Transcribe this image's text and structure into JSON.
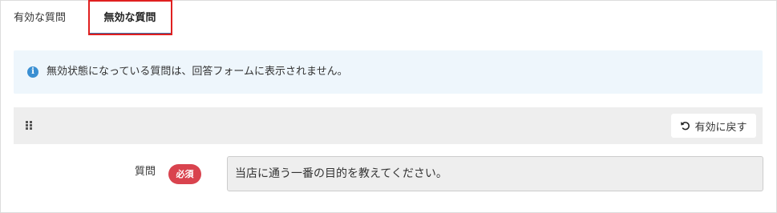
{
  "tabs": [
    {
      "label": "有効な質問",
      "active": false
    },
    {
      "label": "無効な質問",
      "active": true
    }
  ],
  "alert": {
    "icon": "info-icon",
    "text": "無効状態になっている質問は、回答フォームに表示されません。"
  },
  "card": {
    "drag_icon": "drag-handle-icon",
    "restore_button": {
      "icon": "undo-icon",
      "label": "有効に戻す"
    }
  },
  "question": {
    "label": "質問",
    "required_badge": "必須",
    "value": "当店に通う一番の目的を教えてください。"
  },
  "colors": {
    "tab_underline": "#3b6fa8",
    "highlight": "#e02020",
    "alert_bg": "#eef6fc",
    "info_icon": "#3a8fd2",
    "required_badge": "#d9434e",
    "card_header_bg": "#eeeeee"
  }
}
